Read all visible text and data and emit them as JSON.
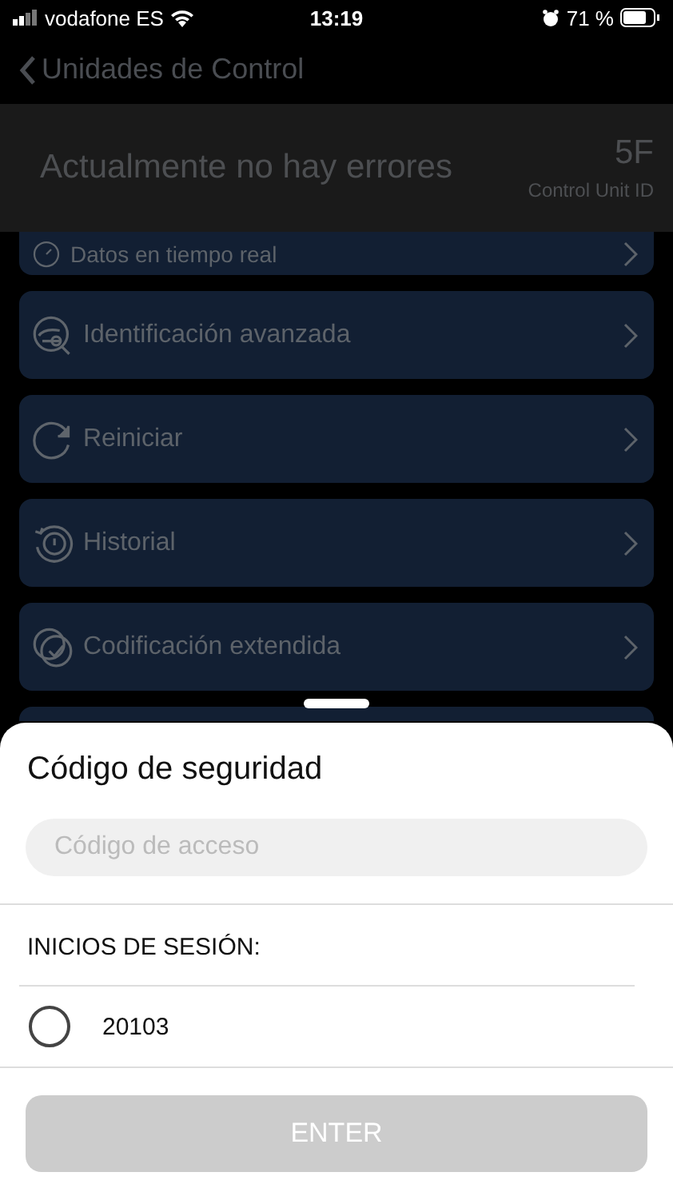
{
  "status_bar": {
    "carrier": "vodafone ES",
    "time": "13:19",
    "battery_text": "71 %"
  },
  "nav": {
    "back_label": "Unidades de Control"
  },
  "header": {
    "message": "Actualmente no hay errores",
    "unit_id": "5F",
    "unit_id_label": "Control Unit ID"
  },
  "menu": [
    {
      "label": "Datos en tiempo real",
      "kind": "realtime"
    },
    {
      "label": "Identificación avanzada",
      "kind": "identification"
    },
    {
      "label": "Reiniciar",
      "kind": "reset"
    },
    {
      "label": "Historial",
      "kind": "history"
    },
    {
      "label": "Codificación extendida",
      "kind": "coding"
    }
  ],
  "sheet": {
    "title": "Código de seguridad",
    "field": {
      "placeholder": "Código de acceso"
    },
    "logins_label": "INICIOS DE SESIÓN:",
    "logins": [
      {
        "label": "20103",
        "selected": false
      }
    ],
    "button": {
      "label": "ENTER",
      "disabled": true
    }
  }
}
